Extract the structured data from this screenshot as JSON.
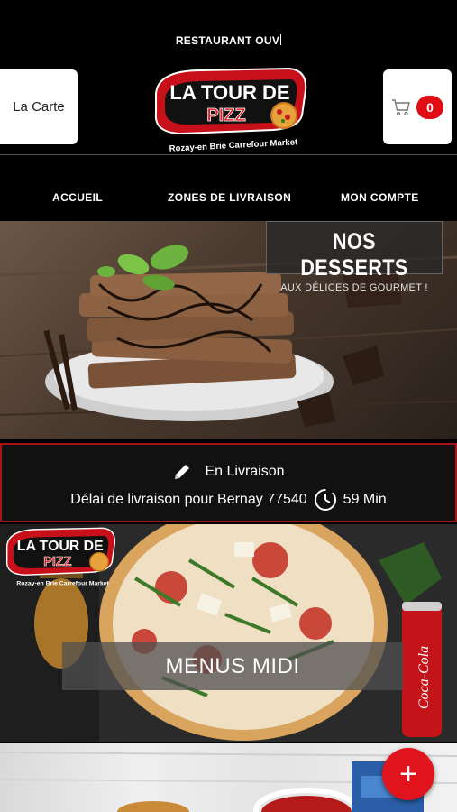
{
  "header": {
    "status_text": "RESTAURANT OUV",
    "carte_label": "La Carte",
    "cart_count": "0"
  },
  "logo": {
    "line1": "LA TOUR DE",
    "line2": "PIZZ",
    "subtitle": "Rozay-en Brie Carrefour Market"
  },
  "nav": {
    "items": [
      {
        "label": "ACCUEIL"
      },
      {
        "label": "ZONES DE LIVRAISON"
      },
      {
        "label": "MON COMPTE"
      }
    ]
  },
  "hero": {
    "title": "NOS DESSERTS",
    "subtitle": "AUX DÉLICES DE GOURMET !"
  },
  "delivery": {
    "mode": "En Livraison",
    "delay_text": "Délai de livraison pour Bernay 77540",
    "delay_value": "59 Min"
  },
  "menu_card": {
    "label": "MENUS MIDI",
    "can_text": "Coca-Cola"
  },
  "fab": {
    "icon": "plus-icon"
  },
  "colors": {
    "accent_red": "#e00d14",
    "background": "#000000",
    "border_red": "#a8141a"
  }
}
